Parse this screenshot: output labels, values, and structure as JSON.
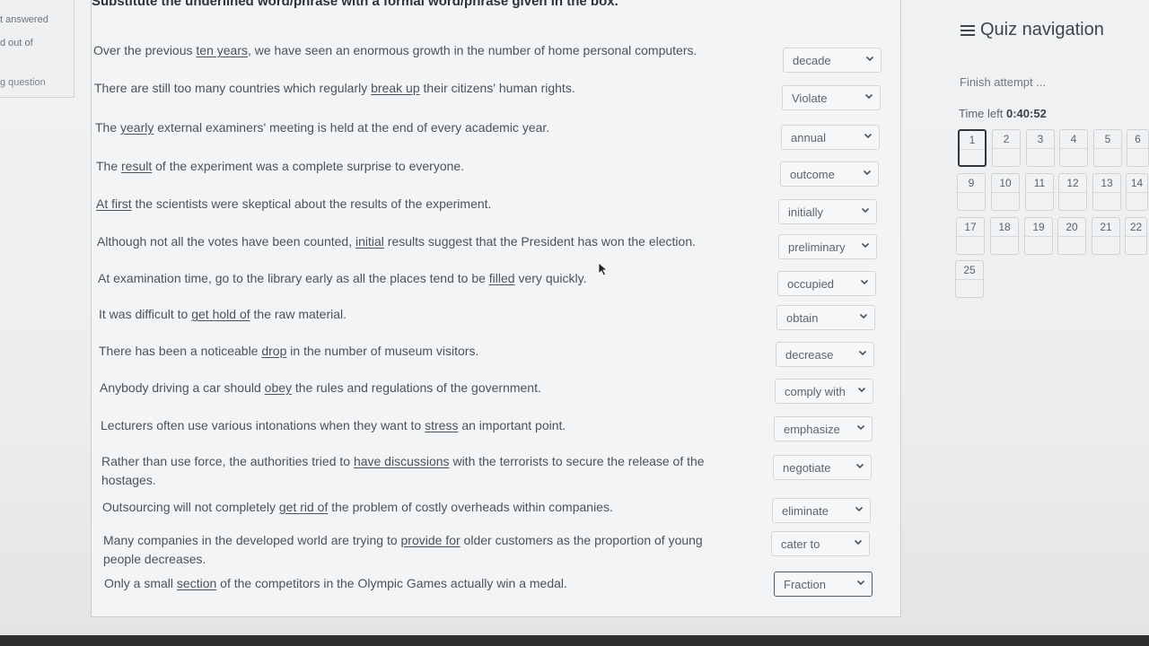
{
  "left_info": {
    "line1": "t answered",
    "line2": "d out of",
    "line3": "g question"
  },
  "instruction": "Substitute the underlined word/phrase with a formal word/phrase given in the box.",
  "questions": [
    {
      "before": "Over the previous ",
      "underlined": "ten years",
      "after": ", we have seen an enormous growth in the number of home personal computers.",
      "answer": "decade"
    },
    {
      "before": "There are still too many countries which regularly ",
      "underlined": "break up",
      "after": " their citizens' human rights.",
      "answer": "Violate"
    },
    {
      "before": "The ",
      "underlined": "yearly",
      "after": " external examiners' meeting is held at the end of every academic year.",
      "answer": "annual"
    },
    {
      "before": "The ",
      "underlined": "result",
      "after": " of the experiment was a complete surprise to everyone.",
      "answer": "outcome"
    },
    {
      "before": "",
      "underlined": "At first",
      "after": " the scientists were skeptical about the results of the experiment.",
      "answer": "initially"
    },
    {
      "before": "Although not all the votes have been counted, ",
      "underlined": "initial",
      "after": " results suggest that the President has won the election.",
      "answer": "preliminary"
    },
    {
      "before": "At examination time, go to the library early as all the places tend to be ",
      "underlined": "filled",
      "after": " very quickly.",
      "answer": "occupied"
    },
    {
      "before": "It was difficult to ",
      "underlined": "get hold of",
      "after": " the raw material.",
      "answer": "obtain"
    },
    {
      "before": "There has been a noticeable ",
      "underlined": "drop",
      "after": " in the number of museum visitors.",
      "answer": "decrease"
    },
    {
      "before": "Anybody driving a car should ",
      "underlined": "obey",
      "after": " the rules and regulations of the government.",
      "answer": "comply with"
    },
    {
      "before": "Lecturers often use various intonations when they want to ",
      "underlined": "stress",
      "after": " an important point.",
      "answer": "emphasize"
    },
    {
      "before": "Rather than use force, the authorities tried to ",
      "underlined": "have discussions",
      "after": " with the terrorists to secure the release of the",
      "cont": "hostages.",
      "answer": "negotiate"
    },
    {
      "before": "Outsourcing will not completely ",
      "underlined": "get rid of",
      "after": " the problem of costly overheads within companies.",
      "answer": "eliminate"
    },
    {
      "before": "Many companies in the developed world are trying to ",
      "underlined": "provide for",
      "after": " older customers as the proportion of young",
      "cont": "people decreases.",
      "answer": "cater to"
    },
    {
      "before": "Only a small ",
      "underlined": "section",
      "after": " of the competitors in the Olympic Games actually win a medal.",
      "answer": "Fraction"
    }
  ],
  "quiz_nav": {
    "title": "Quiz navigation",
    "icon": "hamburger-menu-icon",
    "finish_attempt": "Finish attempt ...",
    "time_left_label": "Time left",
    "time_left_value": "0:40:52",
    "buttons": [
      "1",
      "2",
      "3",
      "4",
      "5",
      "6",
      "9",
      "10",
      "11",
      "12",
      "13",
      "14",
      "17",
      "18",
      "19",
      "20",
      "21",
      "22",
      "25"
    ],
    "current": "1"
  }
}
